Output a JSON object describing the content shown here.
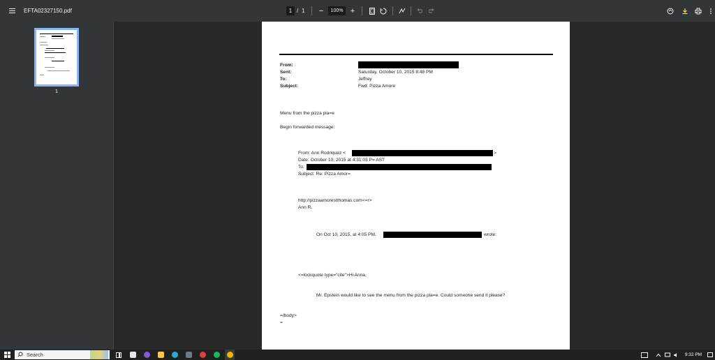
{
  "toolbar": {
    "title": "EFTA02327150.pdf",
    "page_current": "1",
    "page_sep": "/",
    "page_total": "1",
    "zoom_out": "−",
    "zoom_level": "100%",
    "zoom_in": "+"
  },
  "sidebar": {
    "thumbnail_page_number": "1"
  },
  "email": {
    "from_label": "From:",
    "sent_label": "Sent:",
    "sent_value": "Saturday, October 10, 2015 8:48 PM",
    "to_label": "To:",
    "to_value": "Jeffrey",
    "subject_label": "Subject:",
    "subject_value": "Fwd: Pizza Amore",
    "line1": "Menu from the pizza pla=e",
    "line2": "Begin forwarded message:",
    "fwd_from_prefix": "From: Ann Rodriquez <",
    "fwd_from_suffix": ">",
    "fwd_date": "Date: October 10, 2015 at 4:31:03 P= AST",
    "fwd_to": "To:",
    "fwd_subject": "Subject: Re: Pizza Amor=",
    "url": "http://pizzaamorestthomas.com<=r>",
    "sign": "Ann R.",
    "quote_prefix": "On Oct 10, 2015, at 4:05 PM,",
    "quote_suffix": "wrote:",
    "blockquote": "<=lockquote type=\"cite\">Hi Anna,",
    "request": "Mr. Epstein would like to see the menu from the pizza pla=e. Could someone send it please?",
    "end1": "=/body>",
    "end2": "="
  },
  "taskbar": {
    "search_label": "Search",
    "time": "9:32 PM"
  }
}
